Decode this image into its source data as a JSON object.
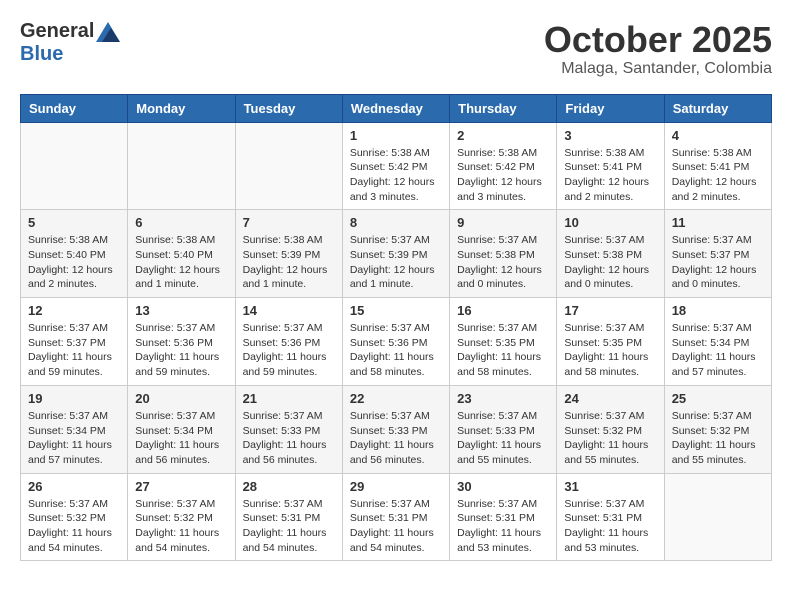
{
  "header": {
    "logo_general": "General",
    "logo_blue": "Blue",
    "month_title": "October 2025",
    "location": "Malaga, Santander, Colombia"
  },
  "days_of_week": [
    "Sunday",
    "Monday",
    "Tuesday",
    "Wednesday",
    "Thursday",
    "Friday",
    "Saturday"
  ],
  "weeks": [
    [
      {
        "day": "",
        "info": ""
      },
      {
        "day": "",
        "info": ""
      },
      {
        "day": "",
        "info": ""
      },
      {
        "day": "1",
        "info": "Sunrise: 5:38 AM\nSunset: 5:42 PM\nDaylight: 12 hours\nand 3 minutes."
      },
      {
        "day": "2",
        "info": "Sunrise: 5:38 AM\nSunset: 5:42 PM\nDaylight: 12 hours\nand 3 minutes."
      },
      {
        "day": "3",
        "info": "Sunrise: 5:38 AM\nSunset: 5:41 PM\nDaylight: 12 hours\nand 2 minutes."
      },
      {
        "day": "4",
        "info": "Sunrise: 5:38 AM\nSunset: 5:41 PM\nDaylight: 12 hours\nand 2 minutes."
      }
    ],
    [
      {
        "day": "5",
        "info": "Sunrise: 5:38 AM\nSunset: 5:40 PM\nDaylight: 12 hours\nand 2 minutes."
      },
      {
        "day": "6",
        "info": "Sunrise: 5:38 AM\nSunset: 5:40 PM\nDaylight: 12 hours\nand 1 minute."
      },
      {
        "day": "7",
        "info": "Sunrise: 5:38 AM\nSunset: 5:39 PM\nDaylight: 12 hours\nand 1 minute."
      },
      {
        "day": "8",
        "info": "Sunrise: 5:37 AM\nSunset: 5:39 PM\nDaylight: 12 hours\nand 1 minute."
      },
      {
        "day": "9",
        "info": "Sunrise: 5:37 AM\nSunset: 5:38 PM\nDaylight: 12 hours\nand 0 minutes."
      },
      {
        "day": "10",
        "info": "Sunrise: 5:37 AM\nSunset: 5:38 PM\nDaylight: 12 hours\nand 0 minutes."
      },
      {
        "day": "11",
        "info": "Sunrise: 5:37 AM\nSunset: 5:37 PM\nDaylight: 12 hours\nand 0 minutes."
      }
    ],
    [
      {
        "day": "12",
        "info": "Sunrise: 5:37 AM\nSunset: 5:37 PM\nDaylight: 11 hours\nand 59 minutes."
      },
      {
        "day": "13",
        "info": "Sunrise: 5:37 AM\nSunset: 5:36 PM\nDaylight: 11 hours\nand 59 minutes."
      },
      {
        "day": "14",
        "info": "Sunrise: 5:37 AM\nSunset: 5:36 PM\nDaylight: 11 hours\nand 59 minutes."
      },
      {
        "day": "15",
        "info": "Sunrise: 5:37 AM\nSunset: 5:36 PM\nDaylight: 11 hours\nand 58 minutes."
      },
      {
        "day": "16",
        "info": "Sunrise: 5:37 AM\nSunset: 5:35 PM\nDaylight: 11 hours\nand 58 minutes."
      },
      {
        "day": "17",
        "info": "Sunrise: 5:37 AM\nSunset: 5:35 PM\nDaylight: 11 hours\nand 58 minutes."
      },
      {
        "day": "18",
        "info": "Sunrise: 5:37 AM\nSunset: 5:34 PM\nDaylight: 11 hours\nand 57 minutes."
      }
    ],
    [
      {
        "day": "19",
        "info": "Sunrise: 5:37 AM\nSunset: 5:34 PM\nDaylight: 11 hours\nand 57 minutes."
      },
      {
        "day": "20",
        "info": "Sunrise: 5:37 AM\nSunset: 5:34 PM\nDaylight: 11 hours\nand 56 minutes."
      },
      {
        "day": "21",
        "info": "Sunrise: 5:37 AM\nSunset: 5:33 PM\nDaylight: 11 hours\nand 56 minutes."
      },
      {
        "day": "22",
        "info": "Sunrise: 5:37 AM\nSunset: 5:33 PM\nDaylight: 11 hours\nand 56 minutes."
      },
      {
        "day": "23",
        "info": "Sunrise: 5:37 AM\nSunset: 5:33 PM\nDaylight: 11 hours\nand 55 minutes."
      },
      {
        "day": "24",
        "info": "Sunrise: 5:37 AM\nSunset: 5:32 PM\nDaylight: 11 hours\nand 55 minutes."
      },
      {
        "day": "25",
        "info": "Sunrise: 5:37 AM\nSunset: 5:32 PM\nDaylight: 11 hours\nand 55 minutes."
      }
    ],
    [
      {
        "day": "26",
        "info": "Sunrise: 5:37 AM\nSunset: 5:32 PM\nDaylight: 11 hours\nand 54 minutes."
      },
      {
        "day": "27",
        "info": "Sunrise: 5:37 AM\nSunset: 5:32 PM\nDaylight: 11 hours\nand 54 minutes."
      },
      {
        "day": "28",
        "info": "Sunrise: 5:37 AM\nSunset: 5:31 PM\nDaylight: 11 hours\nand 54 minutes."
      },
      {
        "day": "29",
        "info": "Sunrise: 5:37 AM\nSunset: 5:31 PM\nDaylight: 11 hours\nand 54 minutes."
      },
      {
        "day": "30",
        "info": "Sunrise: 5:37 AM\nSunset: 5:31 PM\nDaylight: 11 hours\nand 53 minutes."
      },
      {
        "day": "31",
        "info": "Sunrise: 5:37 AM\nSunset: 5:31 PM\nDaylight: 11 hours\nand 53 minutes."
      },
      {
        "day": "",
        "info": ""
      }
    ]
  ]
}
